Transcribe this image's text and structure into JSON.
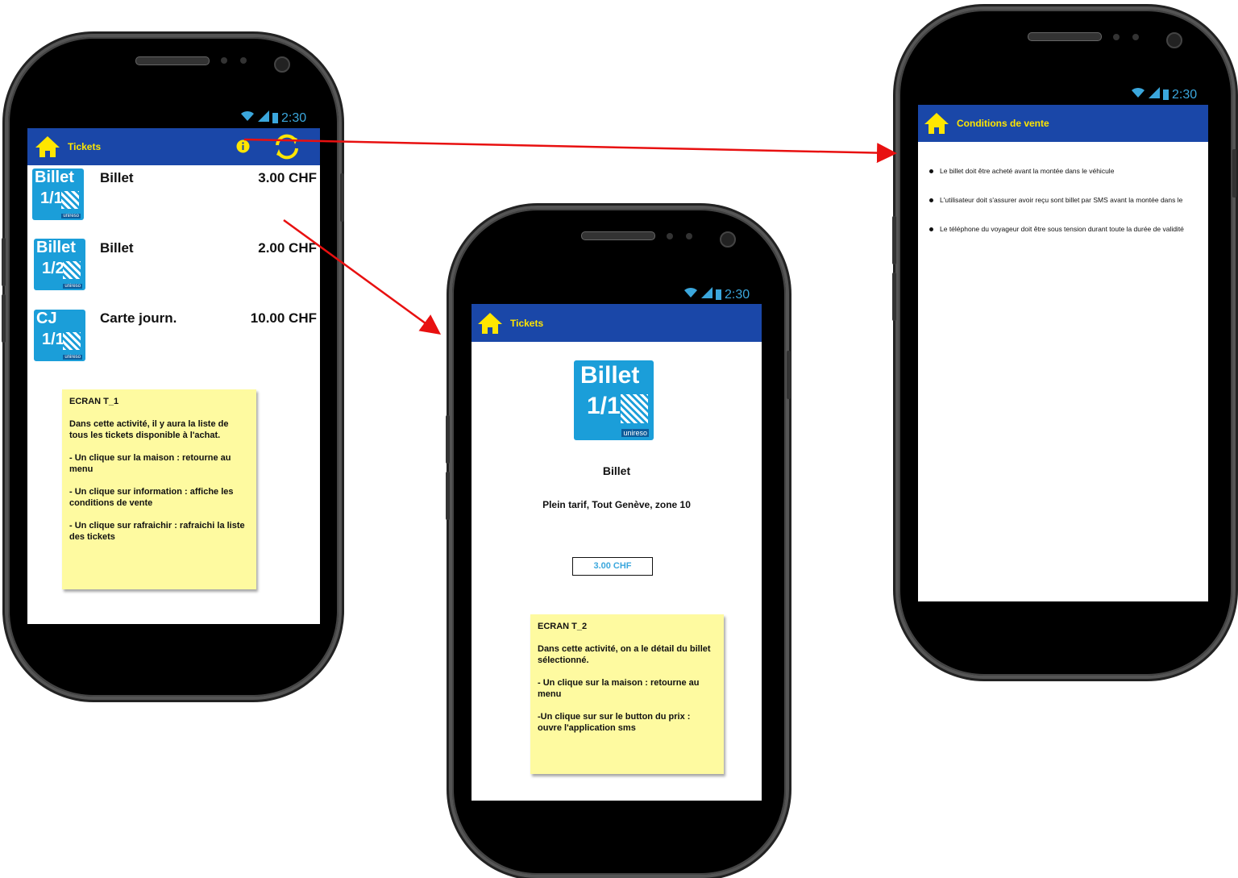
{
  "status": {
    "time": "2:30"
  },
  "screen1": {
    "title": "Tickets",
    "tickets": [
      {
        "logo_top": "Billet",
        "logo_frac": "1/1",
        "logo_brand": "unireso",
        "name": "Billet",
        "price": "3.00 CHF"
      },
      {
        "logo_top": "Billet",
        "logo_frac": "1/2",
        "logo_brand": "unireso",
        "name": "Billet",
        "price": "2.00 CHF"
      },
      {
        "logo_top": "CJ",
        "logo_frac": "1/1",
        "logo_brand": "unireso",
        "name": "Carte journ.",
        "price": "10.00 CHF"
      }
    ],
    "note": "ECRAN T_1\n\nDans cette activité, il y aura la liste de tous les tickets disponible à l'achat.\n\n- Un clique sur la maison : retourne au menu\n\n- Un clique sur information : affiche les conditions de vente\n\n- Un clique sur rafraichir : rafraichi la liste des tickets"
  },
  "screen2": {
    "title": "Tickets",
    "logo_top": "Billet",
    "logo_frac": "1/1",
    "logo_brand": "unireso",
    "name": "Billet",
    "description": "Plein tarif, Tout Genève, zone 10",
    "price_button": "3.00 CHF",
    "note": "ECRAN T_2\n\nDans cette activité, on a le détail du billet sélectionné.\n\n- Un clique sur la maison : retourne au menu\n\n-Un clique sur sur le button du prix : ouvre l'application sms"
  },
  "screen3": {
    "title": "Conditions de vente",
    "conditions": [
      "Le billet doit être acheté avant la montée dans le véhicule",
      "L'utilisateur doit s'assurer avoir reçu sont billet par SMS avant la montée dans le",
      "Le téléphone du voyageur doit être sous tension durant toute la durée de validité"
    ]
  },
  "colors": {
    "appbar": "#1a47a8",
    "title": "#ffe600",
    "status": "#3ba7dd",
    "note": "#fefaa0",
    "arrow": "#e81010",
    "ticket": "#1b9ed9"
  }
}
